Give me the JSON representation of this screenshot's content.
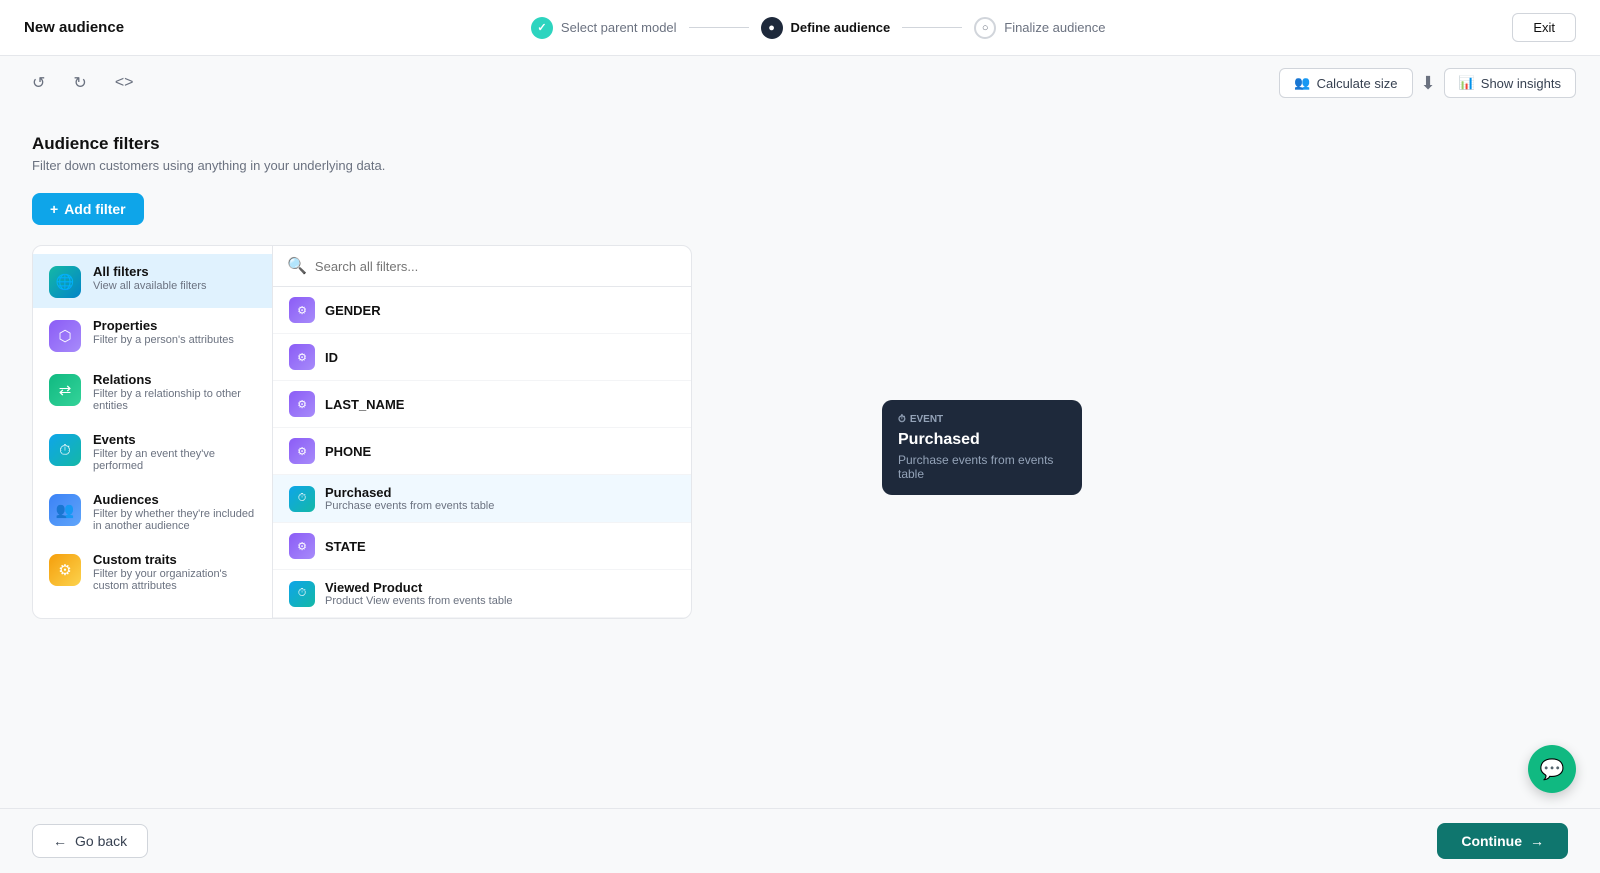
{
  "topnav": {
    "title": "New audience",
    "steps": [
      {
        "id": "select-parent",
        "label": "Select parent model",
        "state": "done"
      },
      {
        "id": "define-audience",
        "label": "Define audience",
        "state": "current"
      },
      {
        "id": "finalize-audience",
        "label": "Finalize audience",
        "state": "pending"
      }
    ],
    "exit_label": "Exit"
  },
  "toolbar": {
    "undo_label": "↺",
    "redo_label": "↻",
    "code_label": "<>",
    "calculate_label": "Calculate size",
    "show_insights_label": "Show insights",
    "divider": "⬇"
  },
  "main": {
    "title": "Audience filters",
    "description": "Filter down customers using anything in your underlying data.",
    "add_filter_label": "+ Add filter"
  },
  "sidebar": {
    "items": [
      {
        "id": "all-filters",
        "label": "All filters",
        "desc": "View all available filters",
        "icon": "globe",
        "active": true
      },
      {
        "id": "properties",
        "label": "Properties",
        "desc": "Filter by a person's attributes",
        "icon": "purple"
      },
      {
        "id": "relations",
        "label": "Relations",
        "desc": "Filter by a relationship to other entities",
        "icon": "green"
      },
      {
        "id": "events",
        "label": "Events",
        "desc": "Filter by an event they've performed",
        "icon": "teal"
      },
      {
        "id": "audiences",
        "label": "Audiences",
        "desc": "Filter by whether they're included in another audience",
        "icon": "blue"
      },
      {
        "id": "custom-traits",
        "label": "Custom traits",
        "desc": "Filter by your organization's custom attributes",
        "icon": "yellow"
      }
    ]
  },
  "search": {
    "placeholder": "Search all filters..."
  },
  "filter_items": [
    {
      "id": "gender",
      "label": "GENDER",
      "sub": "",
      "icon_type": "purple"
    },
    {
      "id": "id",
      "label": "ID",
      "sub": "",
      "icon_type": "purple"
    },
    {
      "id": "last_name",
      "label": "LAST_NAME",
      "sub": "",
      "icon_type": "purple"
    },
    {
      "id": "phone",
      "label": "PHONE",
      "sub": "",
      "icon_type": "purple"
    },
    {
      "id": "purchased",
      "label": "Purchased",
      "sub": "Purchase events from events table",
      "icon_type": "teal",
      "highlighted": true
    },
    {
      "id": "state",
      "label": "STATE",
      "sub": "",
      "icon_type": "purple"
    },
    {
      "id": "viewed-product",
      "label": "Viewed Product",
      "sub": "Product View events from events table",
      "icon_type": "teal"
    }
  ],
  "tooltip": {
    "tag": "EVENT",
    "title": "Purchased",
    "desc": "Purchase events from events table"
  },
  "bottom": {
    "go_back_label": "Go back",
    "continue_label": "Continue →"
  }
}
